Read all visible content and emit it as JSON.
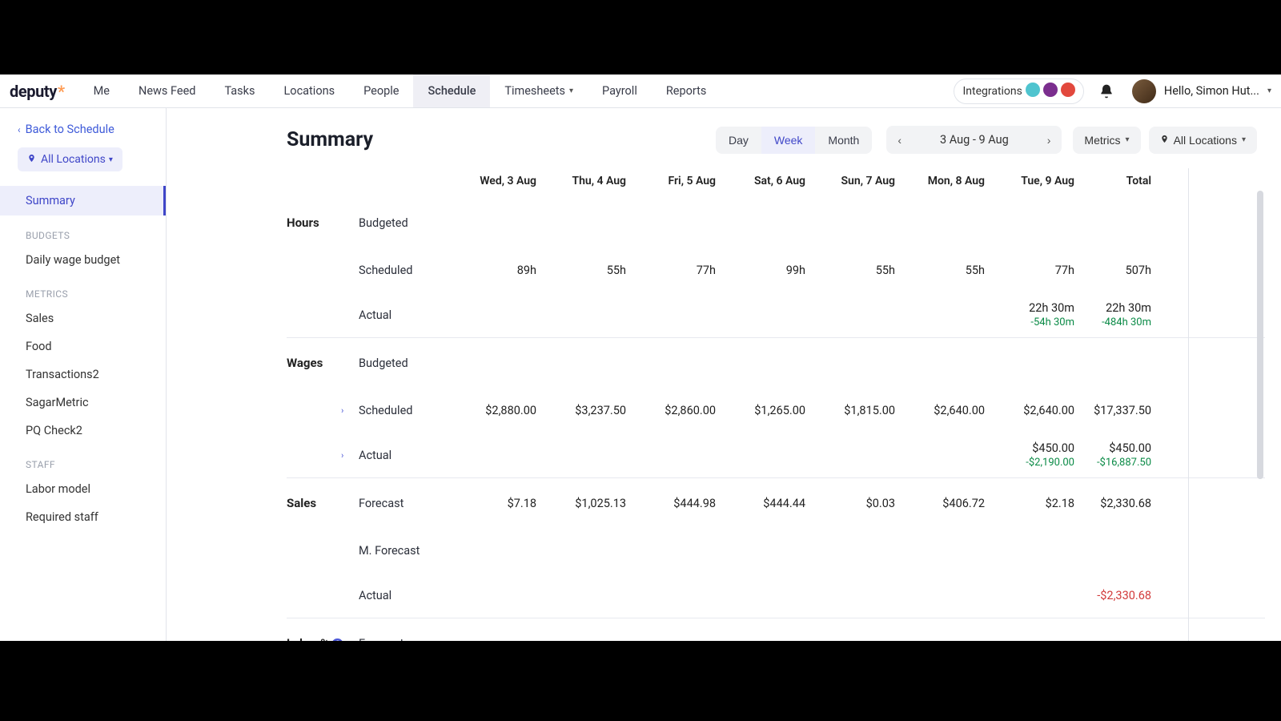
{
  "brand": {
    "name": "deputy",
    "accent": "*"
  },
  "nav": {
    "items": [
      "Me",
      "News Feed",
      "Tasks",
      "Locations",
      "People",
      "Schedule",
      "Timesheets",
      "Payroll",
      "Reports"
    ],
    "active_index": 5,
    "dropdown_indices": [
      6
    ],
    "integrations_label": "Integrations",
    "integrations_dots": [
      "#4fc4cf",
      "#7b2e8e",
      "#e2483d"
    ],
    "user_greeting": "Hello, Simon Hut..."
  },
  "sidebar": {
    "back_label": "Back to Schedule",
    "location_pill": "All Locations",
    "active_item": "Summary",
    "sections": [
      {
        "title": "BUDGETS",
        "items": [
          "Daily wage budget"
        ]
      },
      {
        "title": "METRICS",
        "items": [
          "Sales",
          "Food",
          "Transactions2",
          "SagarMetric",
          "PQ Check2"
        ]
      },
      {
        "title": "STAFF",
        "items": [
          "Labor model",
          "Required staff"
        ]
      }
    ]
  },
  "toolbar": {
    "title": "Summary",
    "views": [
      "Day",
      "Week",
      "Month"
    ],
    "active_view_index": 1,
    "date_range": "3 Aug - 9 Aug",
    "metrics_label": "Metrics",
    "locations_label": "All Locations"
  },
  "table": {
    "headers": [
      "Wed, 3 Aug",
      "Thu, 4 Aug",
      "Fri, 5 Aug",
      "Sat, 6 Aug",
      "Sun, 7 Aug",
      "Mon, 8 Aug",
      "Tue, 9 Aug"
    ],
    "total_header": "Total",
    "sections": [
      {
        "category": "Hours",
        "rows": [
          {
            "label": "Budgeted",
            "cells": [
              "",
              "",
              "",
              "",
              "",
              "",
              ""
            ],
            "total": ""
          },
          {
            "label": "Scheduled",
            "cells": [
              "89h",
              "55h",
              "77h",
              "99h",
              "55h",
              "55h",
              "77h"
            ],
            "total": "507h"
          },
          {
            "label": "Actual",
            "cells": [
              "",
              "",
              "",
              "",
              "",
              "",
              {
                "value": "22h 30m",
                "delta": "-54h 30m"
              }
            ],
            "total": {
              "value": "22h 30m",
              "delta": "-484h 30m"
            }
          }
        ]
      },
      {
        "category": "Wages",
        "rows": [
          {
            "label": "Budgeted",
            "cells": [
              "",
              "",
              "",
              "",
              "",
              "",
              ""
            ],
            "total": ""
          },
          {
            "label": "Scheduled",
            "expandable": true,
            "cells": [
              "$2,880.00",
              "$3,237.50",
              "$2,860.00",
              "$1,265.00",
              "$1,815.00",
              "$2,640.00",
              "$2,640.00"
            ],
            "total": "$17,337.50"
          },
          {
            "label": "Actual",
            "expandable": true,
            "cells": [
              "",
              "",
              "",
              "",
              "",
              "",
              {
                "value": "$450.00",
                "delta": "-$2,190.00"
              }
            ],
            "total": {
              "value": "$450.00",
              "delta": "-$16,887.50"
            }
          }
        ]
      },
      {
        "category": "Sales",
        "rows": [
          {
            "label": "Forecast",
            "cells": [
              "$7.18",
              "$1,025.13",
              "$444.98",
              "$444.44",
              "$0.03",
              "$406.72",
              "$2.18"
            ],
            "total": "$2,330.68"
          },
          {
            "label": "M. Forecast",
            "cells": [
              "",
              "",
              "",
              "",
              "",
              "",
              ""
            ],
            "total": ""
          },
          {
            "label": "Actual",
            "cells": [
              "",
              "",
              "",
              "",
              "",
              "",
              ""
            ],
            "total": {
              "value": "-$2,330.68",
              "negative": true
            }
          }
        ]
      },
      {
        "category": "Labor %",
        "help": true,
        "rows": [
          {
            "label": "Forecast",
            "cells": [
              "",
              "",
              "",
              "",
              "",
              "",
              ""
            ],
            "total": ""
          }
        ]
      }
    ]
  }
}
